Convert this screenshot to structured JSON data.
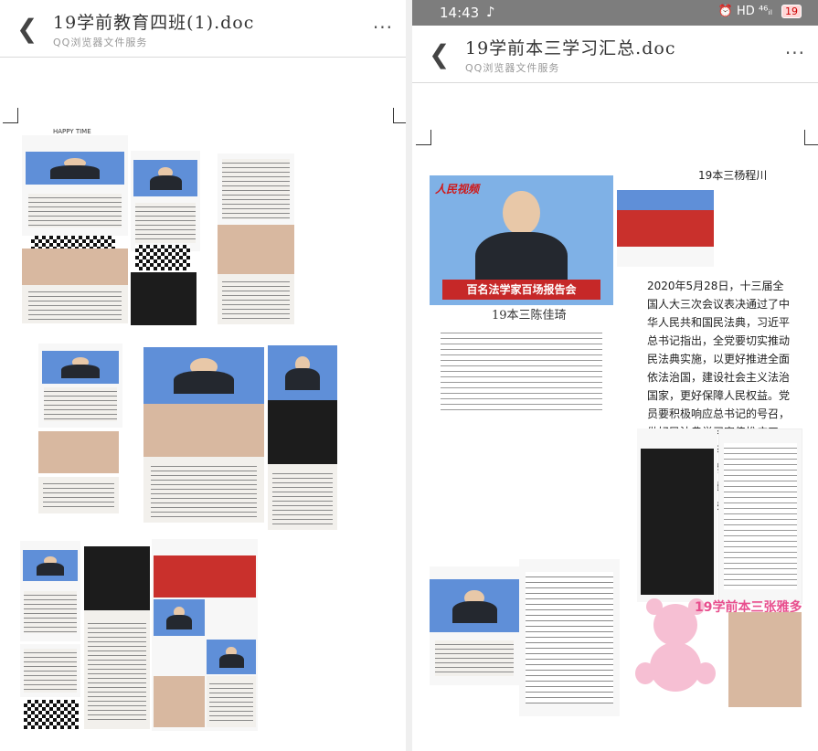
{
  "left": {
    "title": "19学前教育四班(1).doc",
    "subtitle": "QQ浏览器文件服务",
    "menu": "···",
    "happy": "HAPPY TIME"
  },
  "right": {
    "status": {
      "time": "14:43",
      "network": "HD ⁴⁶ᵢₗ",
      "battery": "19"
    },
    "title": "19学前本三学习汇总.doc",
    "subtitle": "QQ浏览器文件服务",
    "menu": "···",
    "author_top": "19本三杨程川",
    "paragraph": "2020年5月28日，十三届全国人大三次会议表决通过了中华人民共和国民法典，习近平总书记指出，全党要切实推动民法典实施，以更好推进全面依法治国，建设社会主义法治国家，更好保障人民权益。党员要积极响应总书记的号召，做好民法典学习宣传推广工作，现阶段学习应当做实掌功夫才好。笨一点，要多做扎根基打基础的马步功夫，少一些好高骛远，化妆取宠的花拳绣腿。",
    "press_logo": "人民视频",
    "banner": "百名法学家百场报告会",
    "handwritten_name": "19本三陈佳琦",
    "pink_title": "19学前本三张雅多"
  },
  "colors": {
    "status_bg": "#7d7d7d",
    "banner_red": "#c62828",
    "pink": "#e84f8e"
  }
}
